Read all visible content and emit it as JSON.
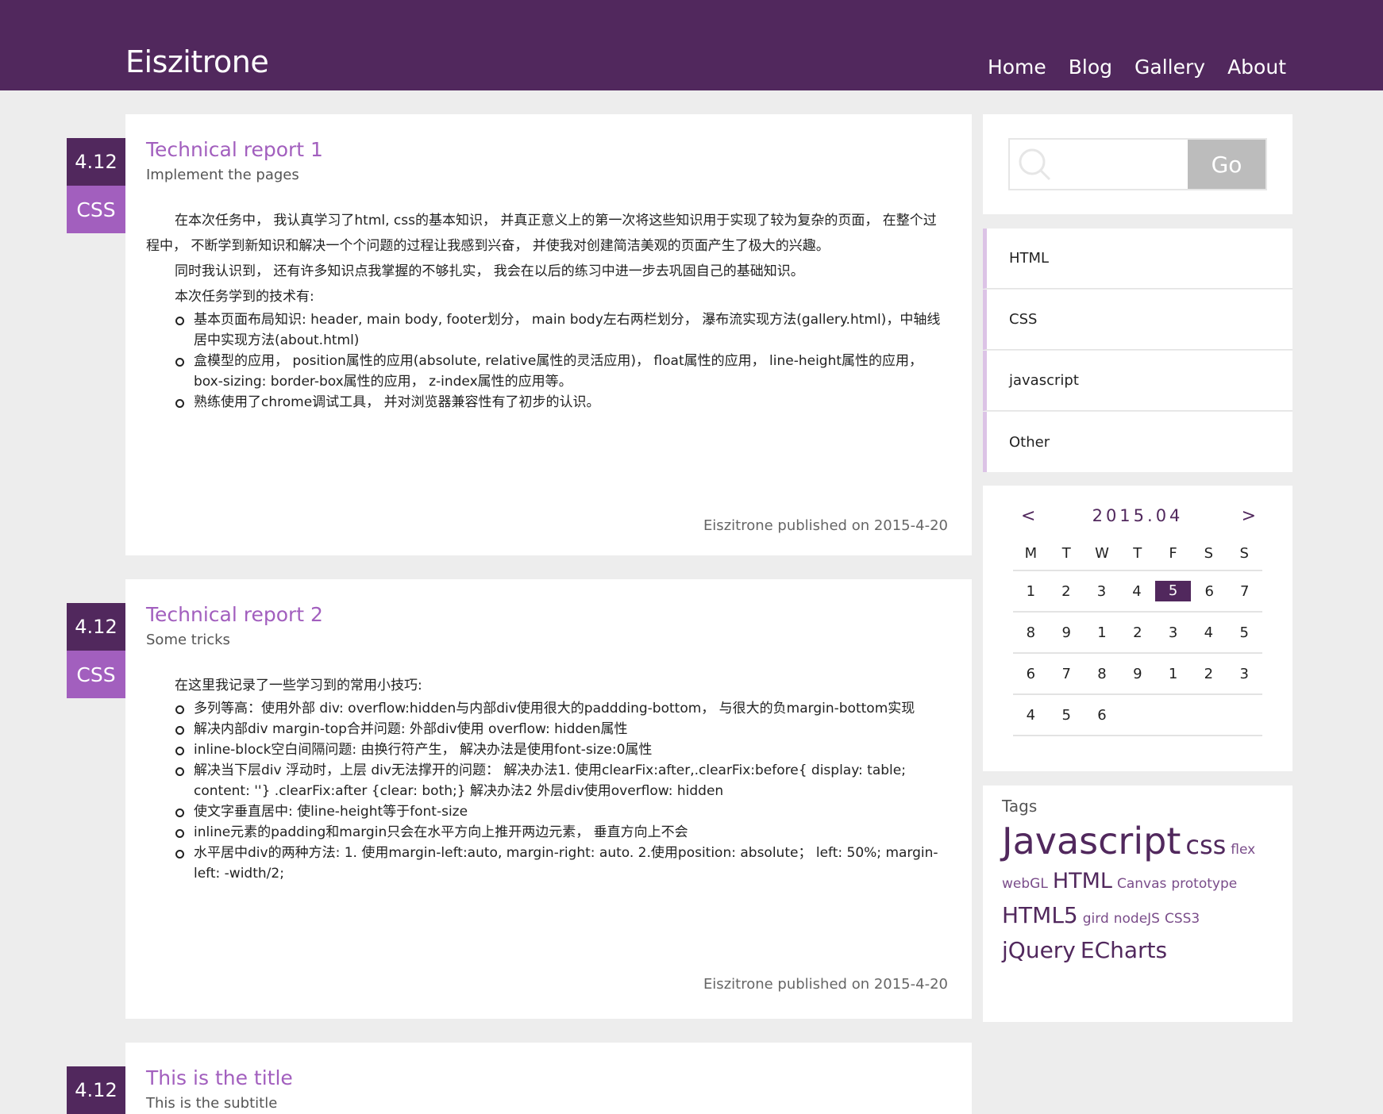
{
  "header": {
    "brand": "Eiszitrone",
    "nav": [
      "Home",
      "Blog",
      "Gallery",
      "About"
    ]
  },
  "posts": [
    {
      "date": "4.12",
      "tag": "CSS",
      "title": "Technical report 1",
      "subtitle": "Implement the pages",
      "paragraphs": [
        "在本次任务中， 我认真学习了html, css的基本知识， 并真正意义上的第一次将这些知识用于实现了较为复杂的页面， 在整个过程中， 不断学到新知识和解决一个个问题的过程让我感到兴奋， 并使我对创建简洁美观的页面产生了极大的兴趣。",
        "同时我认识到， 还有许多知识点我掌握的不够扎实， 我会在以后的练习中进一步去巩固自己的基础知识。",
        "本次任务学到的技术有:"
      ],
      "bullets": [
        "基本页面布局知识: header, main body, footer划分， main body左右两栏划分， 瀑布流实现方法(gallery.html)，中轴线居中实现方法(about.html)",
        "盒模型的应用， position属性的应用(absolute, relative属性的灵活应用)， float属性的应用， line-height属性的应用， box-sizing: border-box属性的应用， z-index属性的应用等。",
        "熟练使用了chrome调试工具， 并对浏览器兼容性有了初步的认识。"
      ],
      "footer": "Eiszitrone published on 2015-4-20"
    },
    {
      "date": "4.12",
      "tag": "CSS",
      "title": "Technical report 2",
      "subtitle": "Some tricks",
      "paragraphs": [
        "在这里我记录了一些学习到的常用小技巧:"
      ],
      "bullets": [
        "多列等高：使用外部 div: overflow:hidden与内部div使用很大的paddding-bottom， 与很大的负margin-bottom实现",
        "解决内部div margin-top合并问题: 外部div使用 overflow: hidden属性",
        "inline-block空白间隔问题: 由换行符产生， 解决办法是使用font-size:0属性",
        "解决当下层div 浮动时，上层 div无法撑开的问题： 解决办法1. 使用clearFix:after,.clearFix:before{ display: table; content: ''} .clearFix:after {clear: both;} 解决办法2 外层div使用overflow: hidden",
        "使文字垂直居中: 使line-height等于font-size",
        "inline元素的padding和margin只会在水平方向上推开两边元素， 垂直方向上不会",
        "水平居中div的两种方法: 1. 使用margin-left:auto, margin-right: auto. 2.使用position: absolute； left: 50%; margin-left: -width/2;"
      ],
      "footer": "Eiszitrone published on 2015-4-20"
    },
    {
      "date": "4.12",
      "title": "This is the title",
      "subtitle": "This is the subtitle"
    }
  ],
  "sidebar": {
    "search": {
      "placeholder": "",
      "go_label": "Go"
    },
    "categories": [
      "HTML",
      "CSS",
      "javascript",
      "Other"
    ],
    "calendar": {
      "prev": "<",
      "next": ">",
      "title": "2015.04",
      "weekdays": [
        "M",
        "T",
        "W",
        "T",
        "F",
        "S",
        "S"
      ],
      "weeks": [
        [
          "1",
          "2",
          "3",
          "4",
          "5",
          "6",
          "7"
        ],
        [
          "8",
          "9",
          "1",
          "2",
          "3",
          "4",
          "5"
        ],
        [
          "6",
          "7",
          "8",
          "9",
          "1",
          "2",
          "3"
        ],
        [
          "4",
          "5",
          "6",
          "",
          "",
          "",
          ""
        ]
      ],
      "highlighted": "5"
    },
    "tags": {
      "title": "Tags",
      "items": [
        "Javascript",
        "css",
        "flex",
        "webGL",
        "HTML",
        "Canvas",
        "prototype",
        "HTML5",
        "gird",
        "nodeJS",
        "CSS3",
        "jQuery",
        "ECharts"
      ]
    }
  },
  "colors": {
    "primary": "#51285d",
    "accent": "#a25fbe",
    "background": "#ededed",
    "search_button": "#bcbcbc"
  }
}
